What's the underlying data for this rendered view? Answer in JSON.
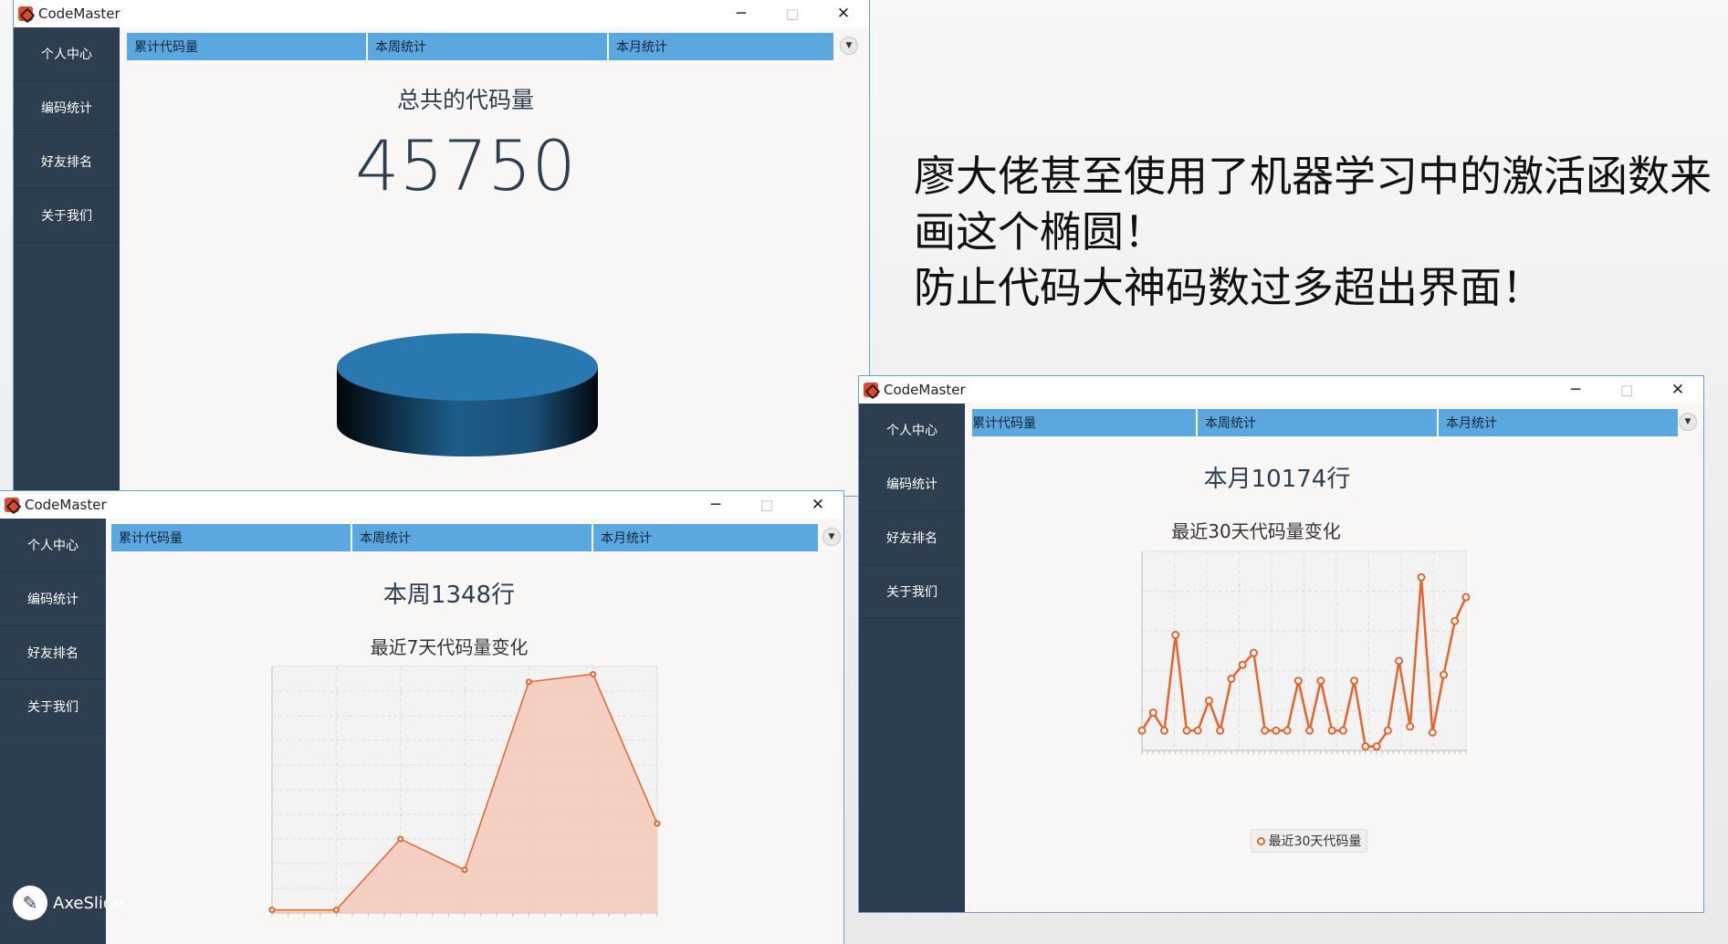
{
  "app": {
    "title": "CodeMaster"
  },
  "sidebar": {
    "items": [
      "个人中心",
      "编码统计",
      "好友排名",
      "关于我们"
    ]
  },
  "tabs": [
    "累计代码量",
    "本周统计",
    "本月统计"
  ],
  "win1": {
    "heading": "总共的代码量",
    "total": "45750"
  },
  "win2": {
    "heading": "本周1348行",
    "chart_title": "最近7天代码量变化"
  },
  "win3": {
    "heading": "本月10174行",
    "chart_title": "最近30天代码量变化",
    "legend": "最近30天代码量"
  },
  "caption": {
    "lines": [
      "廖大佬甚至使用了机器学习中的激活函数来",
      "画这个椭圆！",
      "防止代码大神码数过多超出界面！"
    ]
  },
  "watermark": {
    "text": "AxeSlide"
  },
  "colors": {
    "sidebar": "#2d3e50",
    "tab": "#5ba8e0",
    "line": "#e8642f",
    "area": "#f4c9b8",
    "cylinder": "#2a78b0"
  },
  "chart_data": [
    {
      "type": "area",
      "series": [
        {
          "values": [
            2,
            2,
            48,
            28,
            150,
            155,
            58
          ]
        }
      ],
      "ylim": [
        0,
        160
      ]
    },
    {
      "type": "line",
      "series": [
        {
          "name": "最近30天代码量",
          "values": [
            10,
            19,
            10,
            58,
            10,
            10,
            25,
            10,
            36,
            43,
            49,
            10,
            10,
            10,
            35,
            10,
            35,
            10,
            10,
            35,
            2,
            2,
            10,
            45,
            12,
            87,
            9,
            38,
            65,
            77
          ]
        }
      ],
      "ylim": [
        0,
        100
      ]
    }
  ]
}
